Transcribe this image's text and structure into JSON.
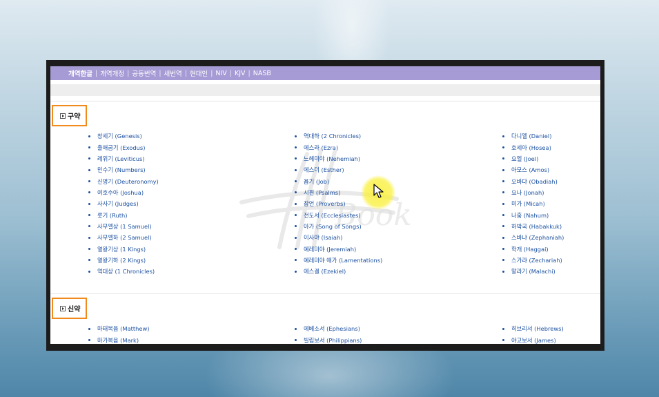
{
  "tabs": [
    {
      "label": "개역한글",
      "active": true
    },
    {
      "label": "개역개정",
      "active": false
    },
    {
      "label": "공동번역",
      "active": false
    },
    {
      "label": "새번역",
      "active": false
    },
    {
      "label": "현대인",
      "active": false
    },
    {
      "label": "NIV",
      "active": false
    },
    {
      "label": "KJV",
      "active": false
    },
    {
      "label": "NASB",
      "active": false
    }
  ],
  "tab_separator": "|",
  "old_testament": {
    "heading": "구약",
    "columns": [
      [
        "창세기 (Genesis)",
        "출애굽기 (Exodus)",
        "레위기 (Leviticus)",
        "민수기 (Numbers)",
        "신명기 (Deuteronomy)",
        "여호수아 (Joshua)",
        "사사기 (Judges)",
        "룻기 (Ruth)",
        "사무엘상 (1 Samuel)",
        "사무엘하 (2 Samuel)",
        "열왕기상 (1 Kings)",
        "열왕기하 (2 Kings)",
        "역대상 (1 Chronicles)"
      ],
      [
        "역대하 (2 Chronicles)",
        "에스라 (Ezra)",
        "느헤미야 (Nehemiah)",
        "에스더 (Esther)",
        "욥기 (Job)",
        "시편 (Psalms)",
        "잠언 (Proverbs)",
        "전도서 (Ecclesiastes)",
        "아가 (Song of Songs)",
        "이사야 (Isaiah)",
        "예레미야 (Jeremiah)",
        "예레미야 애가 (Lamentations)",
        "에스겔 (Ezekiel)"
      ],
      [
        "다니엘 (Daniel)",
        "호세아 (Hosea)",
        "요엘 (Joel)",
        "아모스 (Amos)",
        "오바댜 (Obadiah)",
        "요나 (Jonah)",
        "미가 (Micah)",
        "나훔 (Nahum)",
        "하박국 (Habakkuk)",
        "스바냐 (Zephaniah)",
        "학개 (Haggai)",
        "스가랴 (Zechariah)",
        "말라기 (Malachi)"
      ]
    ]
  },
  "new_testament": {
    "heading": "신약",
    "columns": [
      [
        "마태복음 (Matthew)",
        "마가복음 (Mark)"
      ],
      [
        "에베소서 (Ephesians)",
        "빌립보서 (Philippians)"
      ],
      [
        "히브리서 (Hebrews)",
        "야고보서 (James)"
      ]
    ]
  },
  "watermark_text": "Book",
  "colors": {
    "tab_bar": "#a69bd4",
    "link": "#1a4fa0",
    "highlight_border": "#f08a1c",
    "cursor_highlight": "#f5ec3c"
  }
}
